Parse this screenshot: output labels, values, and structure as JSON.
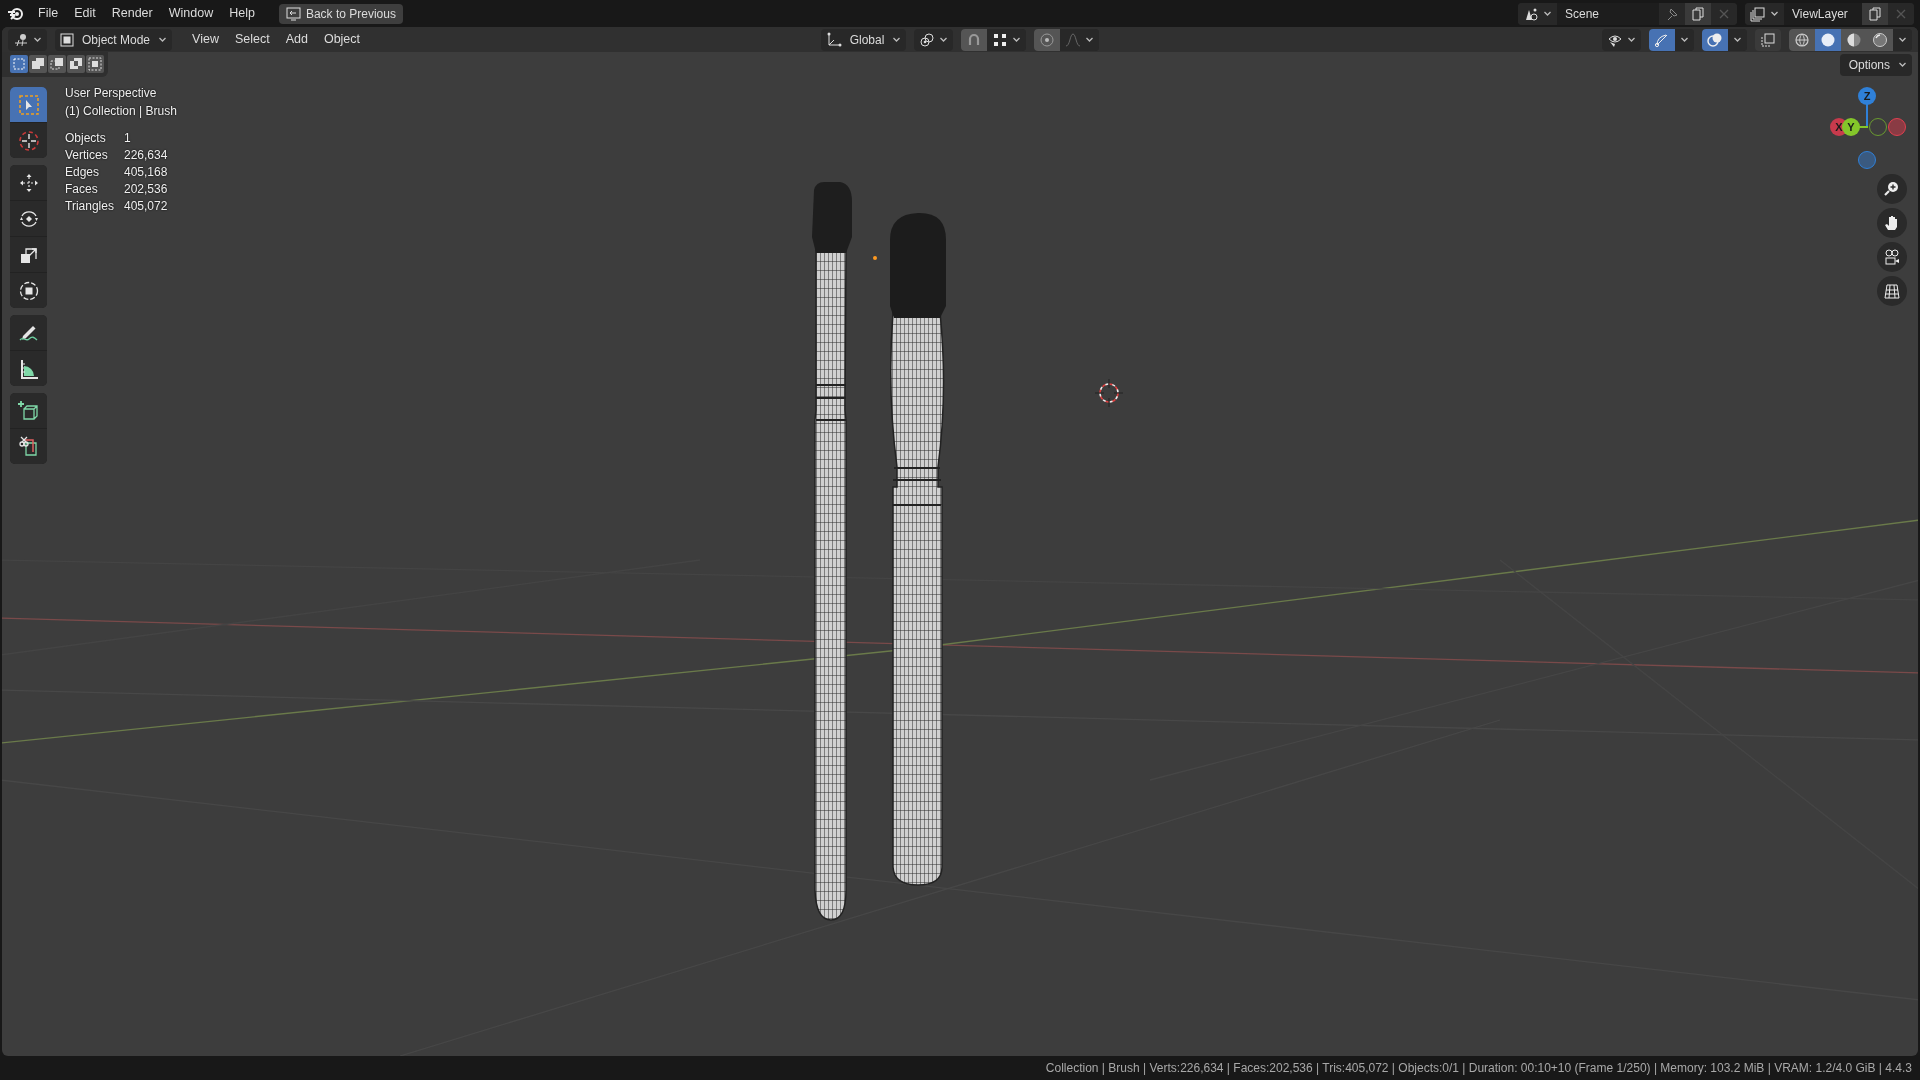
{
  "top_bar": {
    "menus": [
      "File",
      "Edit",
      "Render",
      "Window",
      "Help"
    ],
    "back_button": "Back to Previous",
    "scene": "Scene",
    "view_layer": "ViewLayer"
  },
  "header": {
    "mode": "Object Mode",
    "menus": [
      "View",
      "Select",
      "Add",
      "Object"
    ],
    "orientation": "Global",
    "gizmos_on": true,
    "overlays_on": true,
    "xray_on": false,
    "shading": [
      {
        "kind": "wireframe",
        "selected": false
      },
      {
        "kind": "solid",
        "selected": true
      },
      {
        "kind": "material",
        "selected": false
      },
      {
        "kind": "rendered",
        "selected": false
      }
    ]
  },
  "select_modes": [
    {
      "kind": "new",
      "selected": true
    },
    {
      "kind": "extend",
      "selected": false
    },
    {
      "kind": "subtract",
      "selected": false
    },
    {
      "kind": "difference",
      "selected": false
    },
    {
      "kind": "intersect",
      "selected": false
    }
  ],
  "options_button": "Options",
  "tool_groups": [
    [
      {
        "kind": "select",
        "selected": true
      },
      {
        "kind": "cursor",
        "selected": false
      }
    ],
    [
      {
        "kind": "move",
        "selected": false
      },
      {
        "kind": "rotate",
        "selected": false
      },
      {
        "kind": "scale",
        "selected": false
      },
      {
        "kind": "transform",
        "selected": false
      }
    ],
    [
      {
        "kind": "annotate",
        "selected": false
      },
      {
        "kind": "measure",
        "selected": false
      }
    ],
    [
      {
        "kind": "add-cube",
        "selected": false
      },
      {
        "kind": "cut-cube",
        "selected": false
      }
    ]
  ],
  "viewport": {
    "view_name": "User Perspective",
    "collection": "(1) Collection | Brush",
    "stats": [
      {
        "label": "Objects",
        "value": "1"
      },
      {
        "label": "Vertices",
        "value": "226,634"
      },
      {
        "label": "Edges",
        "value": "405,168"
      },
      {
        "label": "Faces",
        "value": "202,536"
      },
      {
        "label": "Triangles",
        "value": "405,072"
      }
    ]
  },
  "gizmo": {
    "axes": [
      {
        "kind": "z",
        "label": "Z",
        "color": "#2f80d8"
      },
      {
        "kind": "x",
        "label": "X",
        "color": "#c73a4c"
      },
      {
        "kind": "y",
        "label": "Y",
        "color": "#84c62a"
      }
    ]
  },
  "status_bar": "Collection | Brush | Verts:226,634 | Faces:202,536 | Tris:405,072 | Objects:0/1 | Duration: 00:10+10 (Frame 1/250) | Memory: 103.2 MiB | VRAM: 1.2/4.0 GiB | 4.4.3"
}
